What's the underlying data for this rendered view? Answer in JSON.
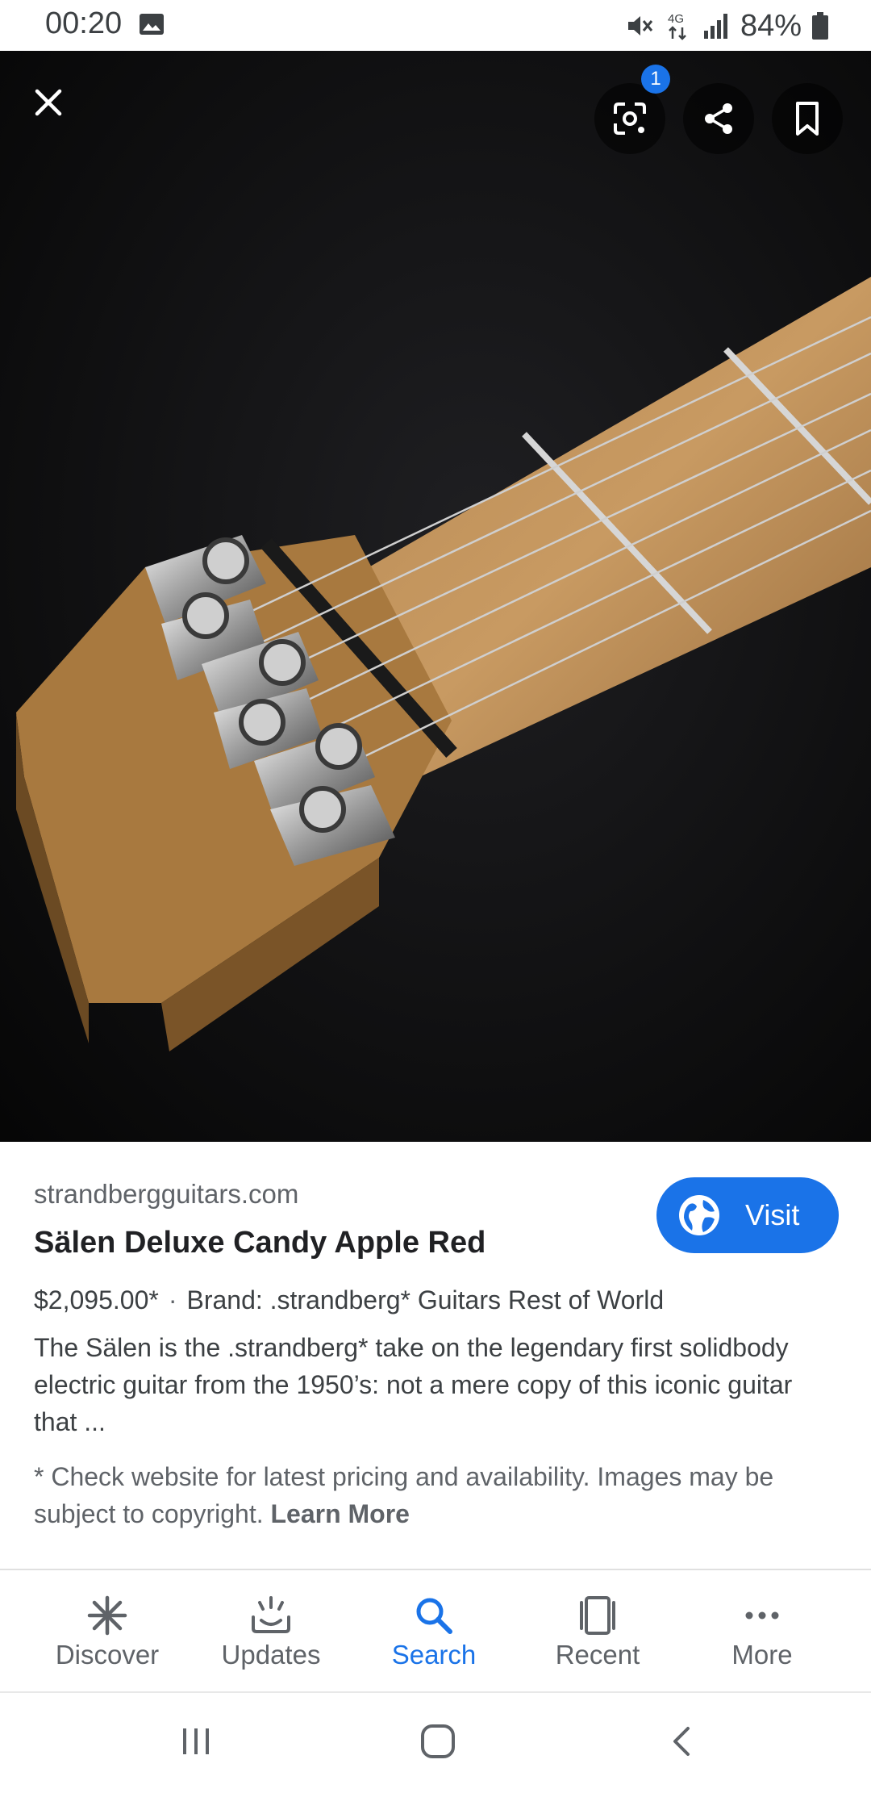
{
  "status_bar": {
    "time": "00:20",
    "battery_percent": "84%",
    "network_label": "4G",
    "icons": [
      "image-icon",
      "mute-icon",
      "4g-icon",
      "signal-icon",
      "battery-icon"
    ]
  },
  "viewer": {
    "image_subject": "guitar headstock photo",
    "lens_badge_count": "1",
    "icons": [
      "close-icon",
      "lens-icon",
      "share-icon",
      "bookmark-icon"
    ]
  },
  "result": {
    "source": "strandbergguitars.com",
    "title": "Sälen Deluxe Candy Apple Red",
    "visit_label": "Visit",
    "price": "$2,095.00*",
    "separator": "·",
    "brand": "Brand: .strandberg* Guitars Rest of World",
    "description": "The Sälen is the .strandberg* take on the legendary first solidbody electric guitar from the 1950’s: not a mere copy of this iconic guitar that ...",
    "disclaimer": "* Check website for latest pricing and availability. Images may be subject to copyright.",
    "learn_more": "Learn More"
  },
  "bottom_nav": {
    "items": [
      {
        "label": "Discover",
        "icon": "asterisk-icon"
      },
      {
        "label": "Updates",
        "icon": "updates-icon"
      },
      {
        "label": "Search",
        "icon": "search-icon"
      },
      {
        "label": "Recent",
        "icon": "recent-icon"
      },
      {
        "label": "More",
        "icon": "more-icon"
      }
    ],
    "active": "Search"
  },
  "colors": {
    "accent": "#1a73e8",
    "viewer_bg": "#0d0d0e",
    "text_primary": "#202124",
    "text_secondary": "#5f6368"
  }
}
